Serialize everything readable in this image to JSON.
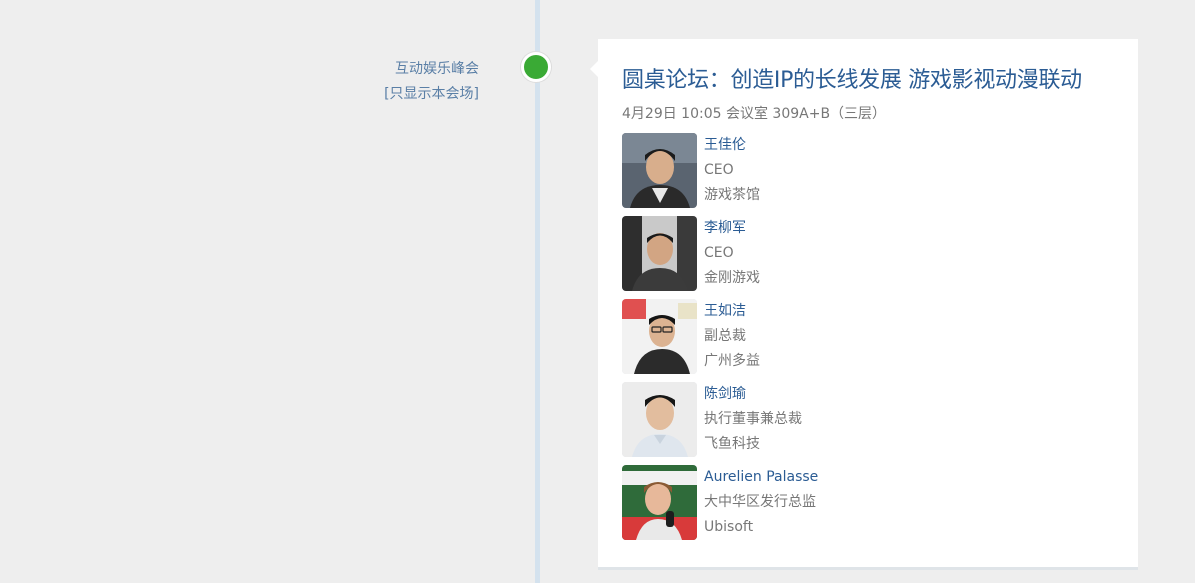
{
  "track": {
    "name": "互动娱乐峰会",
    "filter_label": "[只显示本会场]"
  },
  "session": {
    "title": "圆桌论坛：创造IP的长线发展 游戏影视动漫联动",
    "meta": "4月29日 10:05 会议室 309A+B（三层）",
    "speakers": [
      {
        "name": "王佳伦",
        "title": "CEO",
        "org": "游戏茶馆"
      },
      {
        "name": "李柳军",
        "title": "CEO",
        "org": "金刚游戏"
      },
      {
        "name": "王如洁",
        "title": "副总裁",
        "org": "广州多益"
      },
      {
        "name": "陈剑瑜",
        "title": "执行董事兼总裁",
        "org": "飞鱼科技"
      },
      {
        "name": "Aurelien Palasse",
        "title": "大中华区发行总监",
        "org": "Ubisoft"
      }
    ]
  },
  "colors": {
    "timeline_dot": "#3aaa35",
    "title": "#2b5c94",
    "link": "#5a7fa6"
  }
}
